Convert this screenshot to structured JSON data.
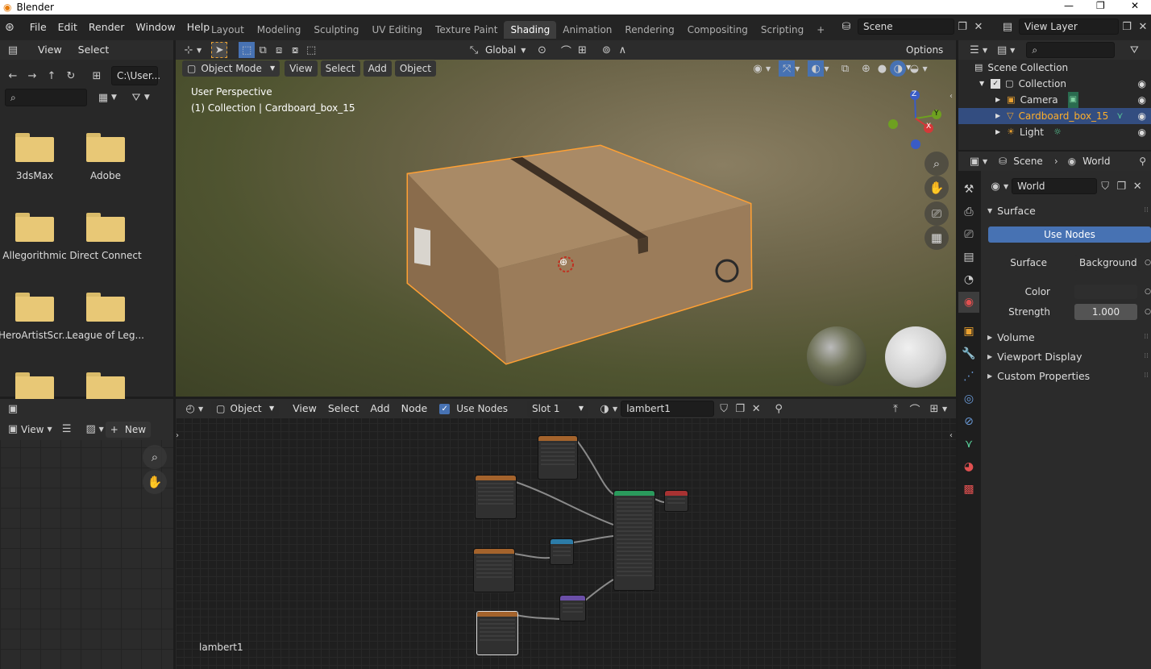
{
  "window": {
    "title": "Blender"
  },
  "menu": {
    "items": [
      "File",
      "Edit",
      "Render",
      "Window",
      "Help"
    ]
  },
  "workspaces": {
    "tabs": [
      "Layout",
      "Modeling",
      "Sculpting",
      "UV Editing",
      "Texture Paint",
      "Shading",
      "Animation",
      "Rendering",
      "Compositing",
      "Scripting"
    ],
    "active": "Shading",
    "add": "+"
  },
  "scene": {
    "name": "Scene"
  },
  "view_layer": {
    "name": "View Layer"
  },
  "file_browser": {
    "menu": [
      "View",
      "Select"
    ],
    "path": "C:\\User...",
    "folders": [
      "3dsMax",
      "Adobe",
      "Allegorithmic",
      "Direct Connect",
      "HeroArtistScr...",
      "League of Leg...",
      "",
      ""
    ]
  },
  "viewport": {
    "mode": "Object Mode",
    "menu": [
      "View",
      "Select",
      "Add",
      "Object"
    ],
    "transform": "Global",
    "options": "Options",
    "overlay_line1": "User Perspective",
    "overlay_line2": "(1) Collection | Cardboard_box_15",
    "gizmo": {
      "x": "X",
      "y": "Y",
      "z": "Z"
    }
  },
  "image_editor": {
    "view": "View",
    "new_label": "New"
  },
  "node_editor": {
    "type": "Object",
    "menu": [
      "View",
      "Select",
      "Add",
      "Node"
    ],
    "use_nodes": "Use Nodes",
    "slot": "Slot 1",
    "material": "lambert1",
    "footer": "lambert1"
  },
  "outliner": {
    "items": [
      {
        "label": "Scene Collection",
        "depth": 0
      },
      {
        "label": "Collection",
        "depth": 1
      },
      {
        "label": "Camera",
        "depth": 2
      },
      {
        "label": "Cardboard_box_15",
        "depth": 2,
        "selected": true
      },
      {
        "label": "Light",
        "depth": 2
      }
    ]
  },
  "properties": {
    "breadcrumb": [
      "Scene",
      "World"
    ],
    "world_name": "World",
    "surface_panel": "Surface",
    "use_nodes_button": "Use Nodes",
    "surface_label": "Surface",
    "surface_value": "Background",
    "color_label": "Color",
    "strength_label": "Strength",
    "strength_value": "1.000",
    "panels": [
      "Volume",
      "Viewport Display",
      "Custom Properties"
    ]
  },
  "colors": {
    "accent": "#4772b3",
    "selection": "#ffa033",
    "header": "#2c2c2c"
  }
}
